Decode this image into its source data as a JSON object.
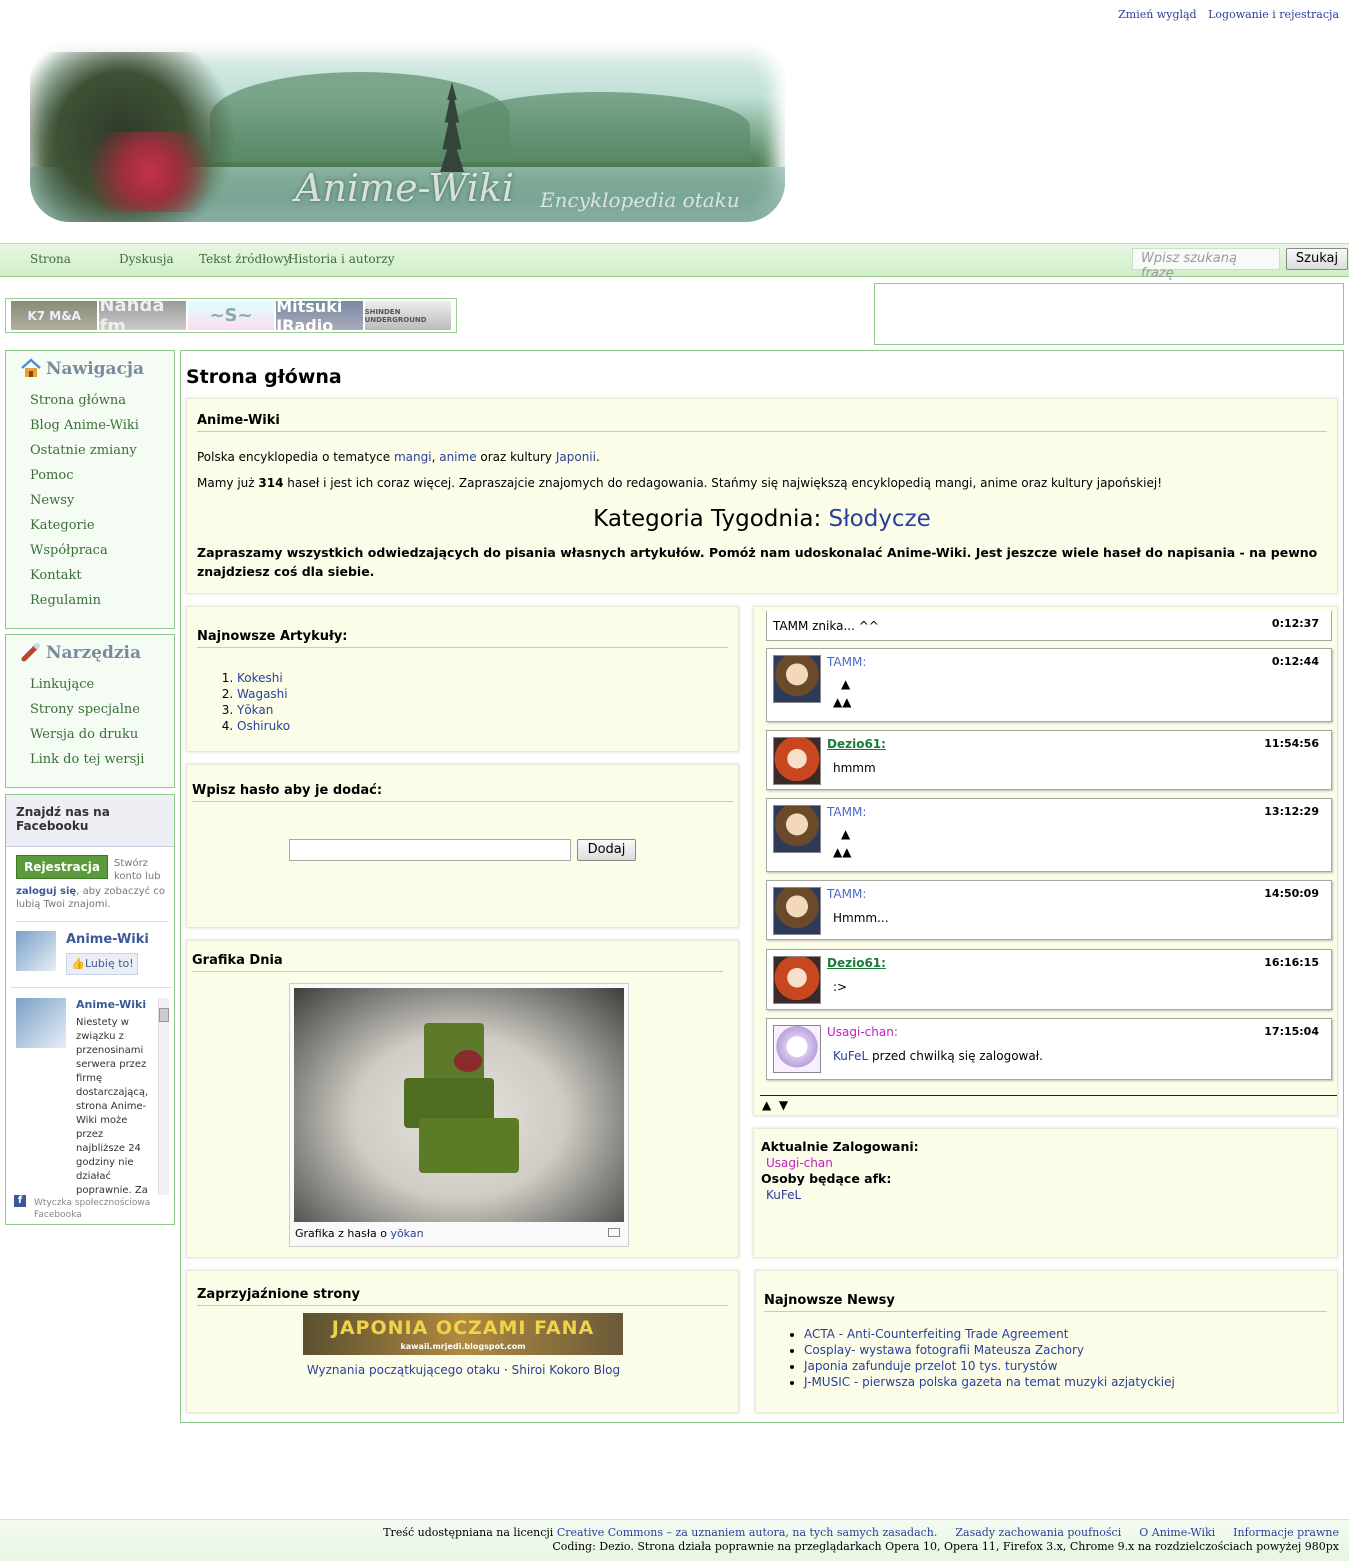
{
  "top_links": {
    "change_look": "Zmień wygląd",
    "login": "Logowanie i rejestracja"
  },
  "banner": {
    "title": "Anime-Wiki",
    "subtitle": "Encyklopedia otaku"
  },
  "tabs": [
    "Strona",
    "Dyskusja",
    "Tekst źródłowy",
    "Historia i autorzy"
  ],
  "search": {
    "placeholder": "Wpisz szukaną frazę",
    "button": "Szukaj"
  },
  "radios": [
    "K7 M&A",
    "Nanda fm",
    "~S~",
    "Mitsuki JRadio",
    "SHINDEN UNDERGROUND"
  ],
  "sidebar": {
    "nav_title": "Nawigacja",
    "nav_items": [
      "Strona główna",
      "Blog Anime-Wiki",
      "Ostatnie zmiany",
      "Pomoc",
      "Newsy",
      "Kategorie",
      "Współpraca",
      "Kontakt",
      "Regulamin"
    ],
    "tools_title": "Narzędzia",
    "tools_items": [
      "Linkujące",
      "Strony specjalne",
      "Wersja do druku",
      "Link do tej wersji"
    ]
  },
  "facebook": {
    "title": "Znajdź nas na Facebooku",
    "register": "Rejestracja",
    "create": "Stwórz konto lub",
    "login": "zaloguj się",
    "login_rest": ", aby zobaczyć co lubią Twoi znajomi.",
    "page_name": "Anime-Wiki",
    "like": "Lubię to!",
    "post_author": "Anime-Wiki",
    "post_text": "Niestety w związku z przenosinami serwera przez firmę dostarczającą, strona Anime-Wiki może przez najbliższe 24 godziny nie działać poprawnie. Za",
    "plugin": "Wtyczka społecznościowa Facebooka"
  },
  "page_title": "Strona główna",
  "intro": {
    "heading": "Anime-Wiki",
    "line1_pre": "Polska encyklopedia o tematyce ",
    "line1_l1": "mangi",
    "line1_sep": ", ",
    "line1_l2": "anime",
    "line1_mid": " oraz kultury ",
    "line1_l3": "Japonii",
    "line1_end": ".",
    "line2_pre": "Mamy już ",
    "line2_count": "314",
    "line2_post": " haseł i jest ich coraz więcej. Zapraszajcie znajomych do redagowania. Stańmy się największą encyklopedią mangi, anime oraz kultury japońskiej!",
    "cat_label": "Kategoria Tygodnia: ",
    "cat_link": "Słodycze",
    "invite": "Zapraszamy wszystkich odwiedzających do pisania własnych artykułów. Pomóż nam udoskonalać Anime-Wiki. Jest jeszcze wiele haseł do napisania - na pewno znajdziesz coś dla siebie."
  },
  "newest": {
    "heading": "Najnowsze Artykuły:",
    "items": [
      "Kokeshi",
      "Wagashi",
      "Yōkan",
      "Oshiruko"
    ]
  },
  "add": {
    "heading": "Wpisz hasło aby je dodać:",
    "button": "Dodaj"
  },
  "picture": {
    "heading": "Grafika Dnia",
    "caption_pre": "Grafika z hasła o ",
    "caption_link": "yōkan"
  },
  "friends": {
    "heading": "Zaprzyjaźnione strony",
    "banner_text": "JAPONIA OCZAMI FANA",
    "banner_url": "kawaii.mrjedi.blogspot.com",
    "link1": "Wyznania początkującego otaku",
    "sep": "·",
    "link2": "Shiroi Kokoro Blog"
  },
  "chat": {
    "first": {
      "text": "TAMM znika... ^^",
      "time": "0:12:37"
    },
    "messages": [
      {
        "user": "TAMM:",
        "time": "0:12:44",
        "text": "▲",
        "text2": "▲▲"
      },
      {
        "user": "Dezio61:",
        "time": "11:54:56",
        "text": "hmmm",
        "text2": ""
      },
      {
        "user": "TAMM:",
        "time": "13:12:29",
        "text": "▲",
        "text2": "▲▲"
      },
      {
        "user": "TAMM:",
        "time": "14:50:09",
        "text": "Hmmm...",
        "text2": ""
      },
      {
        "user": "Dezio61:",
        "time": "16:16:15",
        "text": ":>",
        "text2": ""
      },
      {
        "user": "Usagi-chan:",
        "time": "17:15:04",
        "text_link": "KuFeL",
        "text": " przed chwilką się zalogował.",
        "text2": ""
      }
    ],
    "arrows": "▲  ▼"
  },
  "online": {
    "heading_logged": "Aktualnie Zalogowani:",
    "user1": "Usagi-chan",
    "heading_afk": "Osoby będące afk:",
    "user2": "KuFeL"
  },
  "news": {
    "heading": "Najnowsze Newsy",
    "items": [
      "ACTA - Anti-Counterfeiting Trade Agreement",
      "Cosplay- wystawa fotografii Mateusza Zachory",
      "Japonia zafunduje przelot 10 tys. turystów",
      "J-MUSIC - pierwsza polska gazeta na temat muzyki azjatyckiej"
    ]
  },
  "footer": {
    "license_pre": "Treść udostępniana na licencji ",
    "license_link": "Creative Commons – za uznaniem autora, na tych samych zasadach.",
    "privacy": "Zasady zachowania poufności",
    "about": "O Anime-Wiki",
    "legal": "Informacje prawne",
    "coding": "Coding: Dezio. Strona działa poprawnie na przeglądarkach Opera 10, Opera 11, Firefox 3.x, Chrome 9.x na rozdzielczościach powyżej 980px"
  },
  "colors": {
    "accent_green": "#8ec98a",
    "link_blue": "#2a3f9a",
    "box_bg": "#fcfde9",
    "usagi": "#c020c0",
    "dezio": "#1a7a3a"
  }
}
